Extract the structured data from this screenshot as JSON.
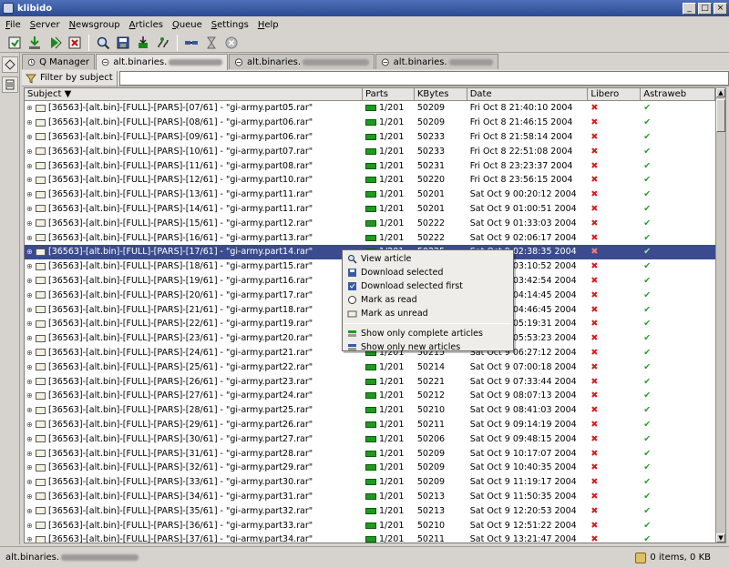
{
  "window": {
    "title": "klibido"
  },
  "menu": [
    "File",
    "Server",
    "Newsgroup",
    "Articles",
    "Queue",
    "Settings",
    "Help"
  ],
  "toolbar": {
    "icons": [
      "connect-icon",
      "download-icon",
      "download-all-icon",
      "remove-icon",
      "view-icon",
      "save-icon",
      "decode-icon",
      "post-icon",
      "connect-servers-icon",
      "hourglass-icon",
      "stop-icon"
    ]
  },
  "tabs": [
    {
      "label": "Q Manager",
      "icon": "queue-icon"
    },
    {
      "label": "alt.binaries.",
      "icon": "group-icon",
      "active": true
    },
    {
      "label": "alt.binaries.",
      "icon": "group-icon"
    },
    {
      "label": "alt.binaries.",
      "icon": "group-icon"
    }
  ],
  "filter": {
    "label": "Filter by subject",
    "value": ""
  },
  "columns": {
    "subject": "Subject",
    "parts": "Parts",
    "kbytes": "KBytes",
    "date": "Date",
    "libero": "Libero",
    "astraweb": "Astraweb"
  },
  "rows": [
    {
      "subject": "[36563]-[alt.bin]-[FULL]-[PARS]-[07/61] - \"gi-army.part05.rar\"",
      "parts": "1/201",
      "kb": "50209",
      "date": "Fri Oct 8 21:40:10 2004",
      "libero": "x",
      "astra": "check"
    },
    {
      "subject": "[36563]-[alt.bin]-[FULL]-[PARS]-[08/61] - \"gi-army.part06.rar\"",
      "parts": "1/201",
      "kb": "50209",
      "date": "Fri Oct 8 21:46:15 2004",
      "libero": "x",
      "astra": "check"
    },
    {
      "subject": "[36563]-[alt.bin]-[FULL]-[PARS]-[09/61] - \"gi-army.part06.rar\"",
      "parts": "1/201",
      "kb": "50233",
      "date": "Fri Oct 8 21:58:14 2004",
      "libero": "x",
      "astra": "check"
    },
    {
      "subject": "[36563]-[alt.bin]-[FULL]-[PARS]-[10/61] - \"gi-army.part07.rar\"",
      "parts": "1/201",
      "kb": "50233",
      "date": "Fri Oct 8 22:51:08 2004",
      "libero": "x",
      "astra": "check"
    },
    {
      "subject": "[36563]-[alt.bin]-[FULL]-[PARS]-[11/61] - \"gi-army.part08.rar\"",
      "parts": "1/201",
      "kb": "50231",
      "date": "Fri Oct 8 23:23:37 2004",
      "libero": "x",
      "astra": "check"
    },
    {
      "subject": "[36563]-[alt.bin]-[FULL]-[PARS]-[12/61] - \"gi-army.part10.rar\"",
      "parts": "1/201",
      "kb": "50220",
      "date": "Fri Oct 8 23:56:15 2004",
      "libero": "x",
      "astra": "check"
    },
    {
      "subject": "[36563]-[alt.bin]-[FULL]-[PARS]-[13/61] - \"gi-army.part11.rar\"",
      "parts": "1/201",
      "kb": "50201",
      "date": "Sat Oct 9 00:20:12 2004",
      "libero": "x",
      "astra": "check"
    },
    {
      "subject": "[36563]-[alt.bin]-[FULL]-[PARS]-[14/61] - \"gi-army.part11.rar\"",
      "parts": "1/201",
      "kb": "50201",
      "date": "Sat Oct 9 01:00:51 2004",
      "libero": "x",
      "astra": "check"
    },
    {
      "subject": "[36563]-[alt.bin]-[FULL]-[PARS]-[15/61] - \"gi-army.part12.rar\"",
      "parts": "1/201",
      "kb": "50222",
      "date": "Sat Oct 9 01:33:03 2004",
      "libero": "x",
      "astra": "check"
    },
    {
      "subject": "[36563]-[alt.bin]-[FULL]-[PARS]-[16/61] - \"gi-army.part13.rar\"",
      "parts": "1/201",
      "kb": "50222",
      "date": "Sat Oct 9 02:06:17 2004",
      "libero": "x",
      "astra": "check"
    },
    {
      "subject": "[36563]-[alt.bin]-[FULL]-[PARS]-[17/61] - \"gi-army.part14.rar\"",
      "parts": "1/201",
      "kb": "50225",
      "date": "Sat Oct 9 02:38:35 2004",
      "libero": "x",
      "astra": "check",
      "selected": true
    },
    {
      "subject": "[36563]-[alt.bin]-[FULL]-[PARS]-[18/61] - \"gi-army.part15.rar\"",
      "parts": "1/201",
      "kb": "50216",
      "date": "Sat Oct 9 03:10:52 2004",
      "libero": "x",
      "astra": "check"
    },
    {
      "subject": "[36563]-[alt.bin]-[FULL]-[PARS]-[19/61] - \"gi-army.part16.rar\"",
      "parts": "1/201",
      "kb": "50219",
      "date": "Sat Oct 9 03:42:54 2004",
      "libero": "x",
      "astra": "check"
    },
    {
      "subject": "[36563]-[alt.bin]-[FULL]-[PARS]-[20/61] - \"gi-army.part17.rar\"",
      "parts": "1/201",
      "kb": "50214",
      "date": "Sat Oct 9 04:14:45 2004",
      "libero": "x",
      "astra": "check"
    },
    {
      "subject": "[36563]-[alt.bin]-[FULL]-[PARS]-[21/61] - \"gi-army.part18.rar\"",
      "parts": "1/201",
      "kb": "50218",
      "date": "Sat Oct 9 04:46:45 2004",
      "libero": "x",
      "astra": "check"
    },
    {
      "subject": "[36563]-[alt.bin]-[FULL]-[PARS]-[22/61] - \"gi-army.part19.rar\"",
      "parts": "1/201",
      "kb": "50212",
      "date": "Sat Oct 9 05:19:31 2004",
      "libero": "x",
      "astra": "check"
    },
    {
      "subject": "[36563]-[alt.bin]-[FULL]-[PARS]-[23/61] - \"gi-army.part20.rar\"",
      "parts": "1/201",
      "kb": "50217",
      "date": "Sat Oct 9 05:53:23 2004",
      "libero": "x",
      "astra": "check"
    },
    {
      "subject": "[36563]-[alt.bin]-[FULL]-[PARS]-[24/61] - \"gi-army.part21.rar\"",
      "parts": "1/201",
      "kb": "50215",
      "date": "Sat Oct 9 06:27:12 2004",
      "libero": "x",
      "astra": "check"
    },
    {
      "subject": "[36563]-[alt.bin]-[FULL]-[PARS]-[25/61] - \"gi-army.part22.rar\"",
      "parts": "1/201",
      "kb": "50214",
      "date": "Sat Oct 9 07:00:18 2004",
      "libero": "x",
      "astra": "check"
    },
    {
      "subject": "[36563]-[alt.bin]-[FULL]-[PARS]-[26/61] - \"gi-army.part23.rar\"",
      "parts": "1/201",
      "kb": "50221",
      "date": "Sat Oct 9 07:33:44 2004",
      "libero": "x",
      "astra": "check"
    },
    {
      "subject": "[36563]-[alt.bin]-[FULL]-[PARS]-[27/61] - \"gi-army.part24.rar\"",
      "parts": "1/201",
      "kb": "50212",
      "date": "Sat Oct 9 08:07:13 2004",
      "libero": "x",
      "astra": "check"
    },
    {
      "subject": "[36563]-[alt.bin]-[FULL]-[PARS]-[28/61] - \"gi-army.part25.rar\"",
      "parts": "1/201",
      "kb": "50210",
      "date": "Sat Oct 9 08:41:03 2004",
      "libero": "x",
      "astra": "check"
    },
    {
      "subject": "[36563]-[alt.bin]-[FULL]-[PARS]-[29/61] - \"gi-army.part26.rar\"",
      "parts": "1/201",
      "kb": "50211",
      "date": "Sat Oct 9 09:14:19 2004",
      "libero": "x",
      "astra": "check"
    },
    {
      "subject": "[36563]-[alt.bin]-[FULL]-[PARS]-[30/61] - \"gi-army.part27.rar\"",
      "parts": "1/201",
      "kb": "50206",
      "date": "Sat Oct 9 09:48:15 2004",
      "libero": "x",
      "astra": "check"
    },
    {
      "subject": "[36563]-[alt.bin]-[FULL]-[PARS]-[31/61] - \"gi-army.part28.rar\"",
      "parts": "1/201",
      "kb": "50209",
      "date": "Sat Oct 9 10:17:07 2004",
      "libero": "x",
      "astra": "check"
    },
    {
      "subject": "[36563]-[alt.bin]-[FULL]-[PARS]-[32/61] - \"gi-army.part29.rar\"",
      "parts": "1/201",
      "kb": "50209",
      "date": "Sat Oct 9 10:40:35 2004",
      "libero": "x",
      "astra": "check"
    },
    {
      "subject": "[36563]-[alt.bin]-[FULL]-[PARS]-[33/61] - \"gi-army.part30.rar\"",
      "parts": "1/201",
      "kb": "50209",
      "date": "Sat Oct 9 11:19:17 2004",
      "libero": "x",
      "astra": "check"
    },
    {
      "subject": "[36563]-[alt.bin]-[FULL]-[PARS]-[34/61] - \"gi-army.part31.rar\"",
      "parts": "1/201",
      "kb": "50213",
      "date": "Sat Oct 9 11:50:35 2004",
      "libero": "x",
      "astra": "check"
    },
    {
      "subject": "[36563]-[alt.bin]-[FULL]-[PARS]-[35/61] - \"gi-army.part32.rar\"",
      "parts": "1/201",
      "kb": "50213",
      "date": "Sat Oct 9 12:20:53 2004",
      "libero": "x",
      "astra": "check"
    },
    {
      "subject": "[36563]-[alt.bin]-[FULL]-[PARS]-[36/61] - \"gi-army.part33.rar\"",
      "parts": "1/201",
      "kb": "50210",
      "date": "Sat Oct 9 12:51:22 2004",
      "libero": "x",
      "astra": "check"
    },
    {
      "subject": "[36563]-[alt.bin]-[FULL]-[PARS]-[37/61] - \"gi-army.part34.rar\"",
      "parts": "1/201",
      "kb": "50211",
      "date": "Sat Oct 9 13:21:47 2004",
      "libero": "x",
      "astra": "check"
    }
  ],
  "context_menu": {
    "items": [
      {
        "label": "View article",
        "icon": "magnifier-icon"
      },
      {
        "label": "Download selected",
        "icon": "download-disk-icon"
      },
      {
        "label": "Download selected first",
        "icon": "download-first-icon"
      },
      {
        "label": "Mark as read",
        "icon": "mark-read-icon"
      },
      {
        "label": "Mark as unread",
        "icon": "mark-unread-icon"
      },
      {
        "separator": true
      },
      {
        "label": "Show only complete articles",
        "icon": "filter-complete-icon"
      },
      {
        "label": "Show only new articles",
        "icon": "filter-new-icon"
      }
    ]
  },
  "status": {
    "left": "alt.binaries.",
    "right": "0 items, 0 KB"
  },
  "colors": {
    "selection": "#3c4b8f",
    "titlebar": "#2c4a93",
    "parts_bar": "#1f9a1f",
    "libero_x": "#d12020",
    "astra_check": "#2a9a2a"
  }
}
